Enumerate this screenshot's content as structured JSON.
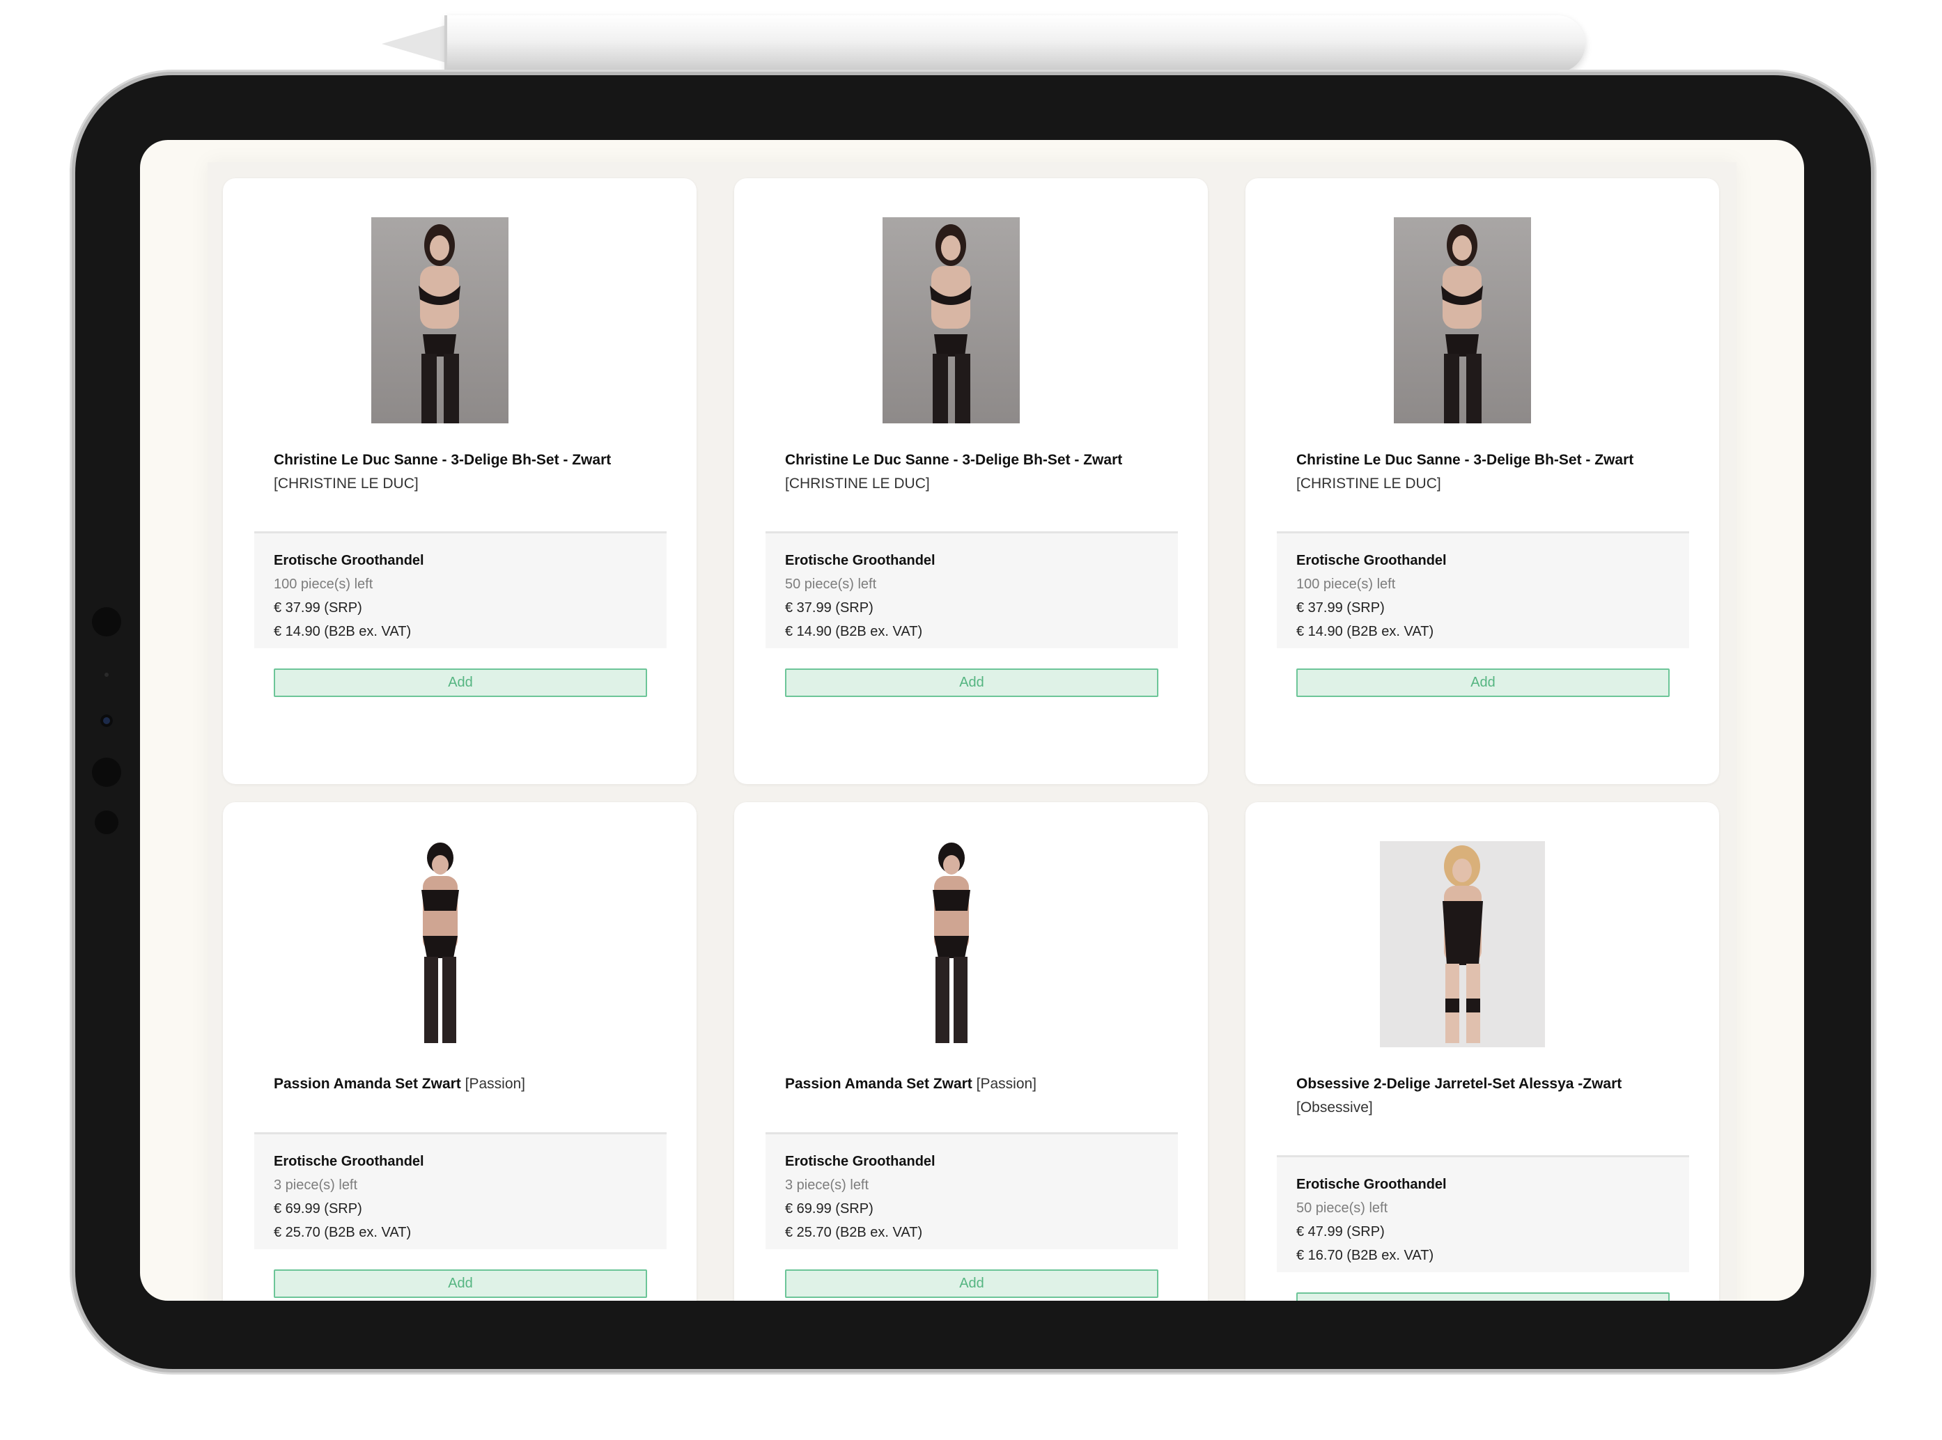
{
  "products": [
    {
      "name": "Christine Le Duc Sanne - 3-Delige Bh-Set - Zwart",
      "brand": "[CHRISTINE LE DUC]",
      "seller": "Erotische Groothandel",
      "stock": "100 piece(s) left",
      "srp": "€ 37.99 (SRP)",
      "b2b": "€ 14.90 (B2B ex. VAT)",
      "add_label": "Add"
    },
    {
      "name": "Christine Le Duc Sanne - 3-Delige Bh-Set - Zwart",
      "brand": "[CHRISTINE LE DUC]",
      "seller": "Erotische Groothandel",
      "stock": "50 piece(s) left",
      "srp": "€ 37.99 (SRP)",
      "b2b": "€ 14.90 (B2B ex. VAT)",
      "add_label": "Add"
    },
    {
      "name": "Christine Le Duc Sanne - 3-Delige Bh-Set - Zwart",
      "brand": "[CHRISTINE LE DUC]",
      "seller": "Erotische Groothandel",
      "stock": "100 piece(s) left",
      "srp": "€ 37.99 (SRP)",
      "b2b": "€ 14.90 (B2B ex. VAT)",
      "add_label": "Add"
    },
    {
      "name": "Passion Amanda Set Zwart",
      "brand": "[Passion]",
      "seller": "Erotische Groothandel",
      "stock": "3 piece(s) left",
      "srp": "€ 69.99 (SRP)",
      "b2b": "€ 25.70 (B2B ex. VAT)",
      "add_label": "Add"
    },
    {
      "name": "Passion Amanda Set Zwart",
      "brand": "[Passion]",
      "seller": "Erotische Groothandel",
      "stock": "3 piece(s) left",
      "srp": "€ 69.99 (SRP)",
      "b2b": "€ 25.70 (B2B ex. VAT)",
      "add_label": "Add"
    },
    {
      "name": "Obsessive 2-Delige Jarretel-Set Alessya -Zwart",
      "brand": "[Obsessive]",
      "seller": "Erotische Groothandel",
      "stock": "50 piece(s) left",
      "srp": "€ 47.99 (SRP)",
      "b2b": "€ 16.70 (B2B ex. VAT)",
      "add_label": ""
    }
  ],
  "colors": {
    "accent_green": "#6cc598",
    "button_bg": "#dff2e7",
    "page_bg": "#fbf9f3",
    "device": "#161616"
  },
  "icons": [
    "apple-pencil",
    "front-camera",
    "product-photo"
  ]
}
